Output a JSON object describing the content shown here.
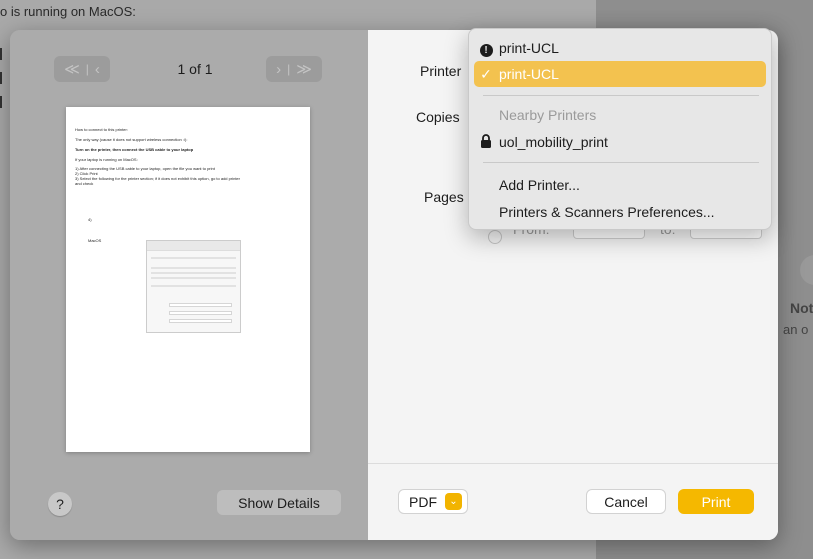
{
  "background": {
    "top_text": "o is running on MacOS:",
    "right_text_bold": "Not",
    "right_text": "an o"
  },
  "preview": {
    "page_count": "1 of 1",
    "prev_first_icon": "first-page-icon",
    "prev_icon": "previous-page-icon",
    "next_icon": "next-page-icon",
    "last_icon": "last-page-icon",
    "page_lines": [
      "How to connect to this printer:",
      "The only way (cause it does not support wireless connection :/):",
      "Turn on the printer, then connect the USB cable to your laptop",
      "If your laptop is running on MacOS:",
      "1)  After connecting the USB cable to your laptop, open the file you want to print",
      "2)  Click Print",
      "3)  Select the following for the printer section; if it does not exhibit this option, go to add printer",
      "      and check"
    ],
    "step_label": "4)",
    "os_label": "MacOS"
  },
  "footer_left": {
    "help_label": "?",
    "details_label": "Show Details"
  },
  "settings": {
    "printer_label": "Printer",
    "copies_label": "Copies",
    "pages_label": "Pages",
    "from_label": "From:",
    "to_label": "to:"
  },
  "footer_right": {
    "pdf_label": "PDF",
    "pdf_chevron_icon": "chevron-down-icon",
    "cancel_label": "Cancel",
    "print_label": "Print"
  },
  "printer_menu": {
    "items": [
      {
        "label": "print-UCL",
        "icon": "warning-icon"
      },
      {
        "label": "print-UCL",
        "icon": "checkmark-icon",
        "selected": true
      }
    ],
    "nearby_header": "Nearby Printers",
    "nearby_items": [
      {
        "label": "uol_mobility_print",
        "icon": "lock-icon"
      }
    ],
    "actions": [
      {
        "label": "Add Printer..."
      },
      {
        "label": "Printers & Scanners Preferences..."
      }
    ]
  },
  "colors": {
    "accent": "#f5b800",
    "selection": "#f3c24f"
  }
}
